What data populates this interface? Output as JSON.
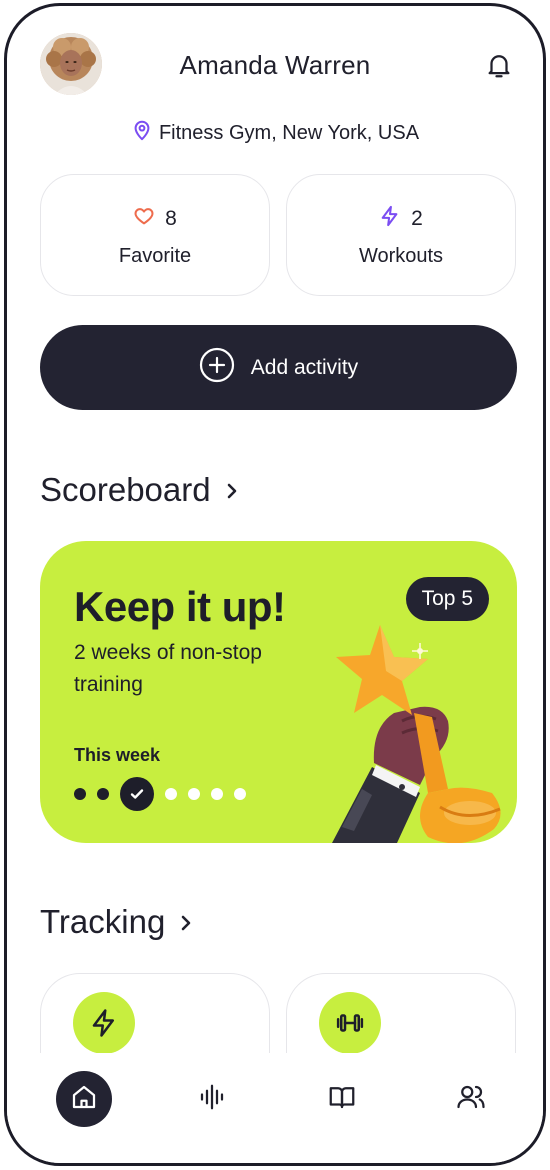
{
  "header": {
    "title": "Amanda Warren",
    "avatar_icon": "user-avatar",
    "notification_icon": "bell-icon",
    "location": "Fitness Gym, New York, USA",
    "location_icon": "map-pin-icon"
  },
  "stats": [
    {
      "icon": "heart-icon",
      "count": "8",
      "label": "Favorite"
    },
    {
      "icon": "lightning-icon",
      "count": "2",
      "label": "Workouts"
    }
  ],
  "add_activity": {
    "label": "Add activity",
    "icon": "plus-circle-icon"
  },
  "scoreboard": {
    "section_title": "Scoreboard",
    "headline": "Keep it up!",
    "subtitle": "2 weeks of non-stop training",
    "badge": "Top 5",
    "week_label": "This week",
    "days_completed": 2,
    "today_index": 2,
    "total_days": 7
  },
  "tracking": {
    "section_title": "Tracking",
    "cards": [
      {
        "icon": "lightning-icon"
      },
      {
        "icon": "dumbbell-icon"
      }
    ]
  },
  "nav": {
    "items": [
      {
        "icon": "home-icon",
        "active": true
      },
      {
        "icon": "activity-waveform-icon",
        "active": false
      },
      {
        "icon": "book-icon",
        "active": false
      },
      {
        "icon": "users-icon",
        "active": false
      }
    ]
  },
  "colors": {
    "accent_lime": "#C7EE3F",
    "dark": "#232332",
    "heart": "#EE6C4D",
    "lightning": "#7B4DF2",
    "pin": "#7B4DF2"
  }
}
